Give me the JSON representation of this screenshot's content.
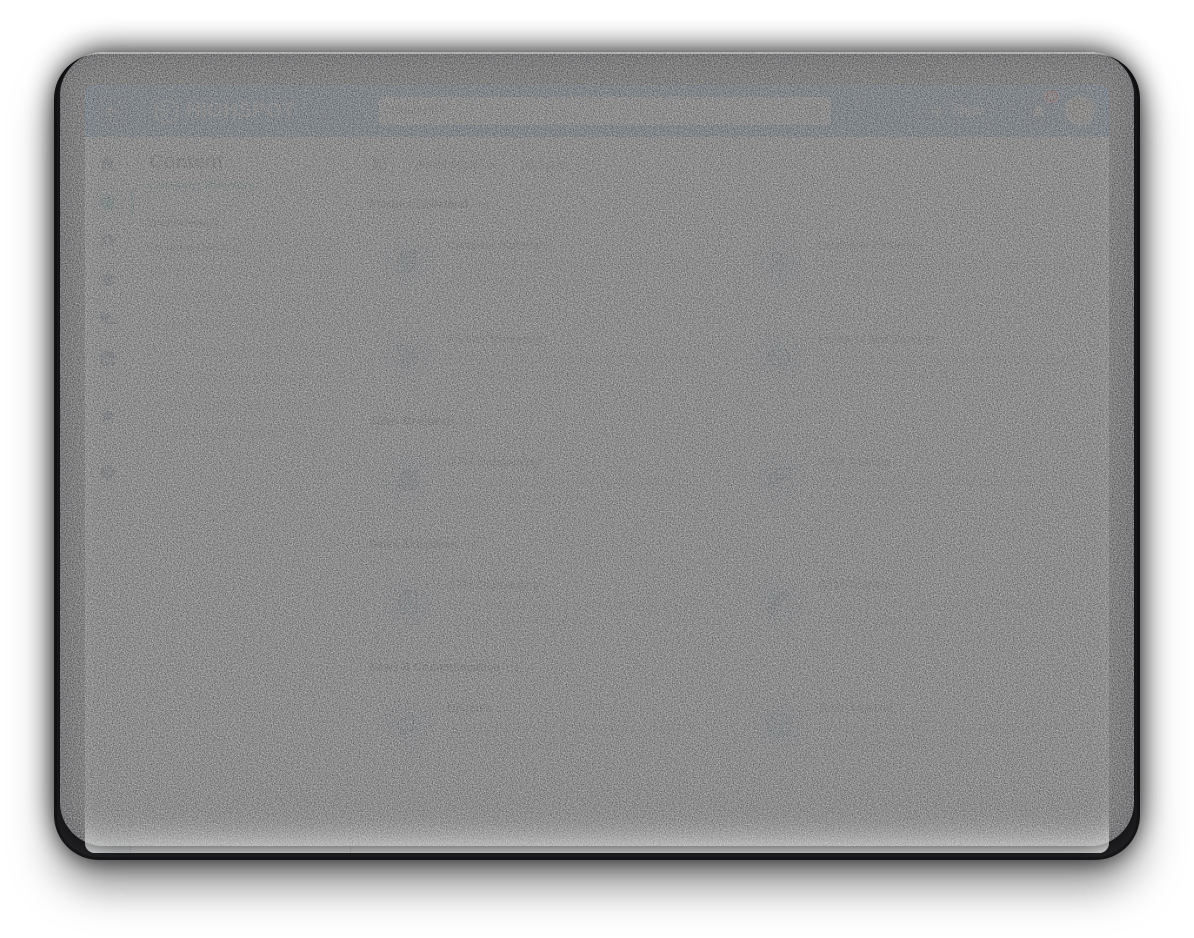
{
  "topbar": {
    "back_icon": "arrow-left-icon",
    "brand_name": "HIGHSPOT",
    "brand_icon": "highspot-logo-icon",
    "search": {
      "value": "Cloud PBX",
      "placeholder": "Search",
      "icon": "search-icon"
    },
    "new_button": {
      "label": "New",
      "icon": "plus-icon"
    },
    "notifications": {
      "icon": "bell-icon",
      "badge": "18"
    },
    "avatar": {
      "icon": "user-avatar"
    },
    "bar_color": "#1271C9"
  },
  "rail": {
    "items": [
      {
        "name": "home",
        "icon": "home-icon",
        "active": false
      },
      {
        "name": "content",
        "icon": "content-circle-icon",
        "active": true
      },
      {
        "name": "people",
        "icon": "person-icon",
        "active": false
      },
      {
        "name": "training",
        "icon": "graduation-cap-icon",
        "active": false
      },
      {
        "name": "conversations",
        "icon": "chat-bubbles-icon",
        "active": false
      },
      {
        "name": "analytics",
        "icon": "bar-chart-icon",
        "active": false
      },
      {
        "name": "favorites",
        "icon": "star-icon",
        "active": false
      },
      {
        "name": "help",
        "icon": "question-circle-icon",
        "active": false
      }
    ],
    "active_color": "#1BA5A0"
  },
  "page": {
    "title": "Content",
    "breadcrumb": "Company Directory",
    "accent_color": "#1BA5A0"
  },
  "spot_directory": {
    "heading": "Spot Directory",
    "active_item": "Company Directory",
    "placeholder_rows": 7
  },
  "toolbar": {
    "view_toggle_icon": "panel-layout-icon",
    "sort_label": "Alphabetical",
    "sort_chevron_icon": "chevron-down-icon",
    "spot_count": "26 Spots"
  },
  "sections": [
    {
      "title": "Product Collateral",
      "count": "4",
      "cards": [
        {
          "title": "Compete Materials",
          "icon": "documents-chart-icon"
        },
        {
          "title": "Customer Evidence",
          "icon": "person-badge-icon"
        },
        {
          "title": "Partner Marketing",
          "icon": "network-nodes-icon"
        },
        {
          "title": "Products and Services",
          "icon": "open-box-icon"
        }
      ]
    },
    {
      "title": "Sales Rediness",
      "count": "8",
      "cards": [
        {
          "title": "GTM Onboarding",
          "icon": "team-star-icon"
        },
        {
          "title": "GTM Training",
          "icon": "presenter-chart-icon"
        }
      ]
    },
    {
      "title": "Sales Execution",
      "count": "8",
      "cards": [
        {
          "title": "GTM Onboarding",
          "icon": "clipboard-plan-icon"
        },
        {
          "title": "GTM Training",
          "icon": "wrench-hammer-icon"
        }
      ]
    },
    {
      "title": "News & Communication",
      "count": "8",
      "cards": [
        {
          "title": "Updates",
          "icon": "megaphone-icon"
        },
        {
          "title": "Team Meeting",
          "icon": "globe-people-icon"
        }
      ]
    }
  ]
}
